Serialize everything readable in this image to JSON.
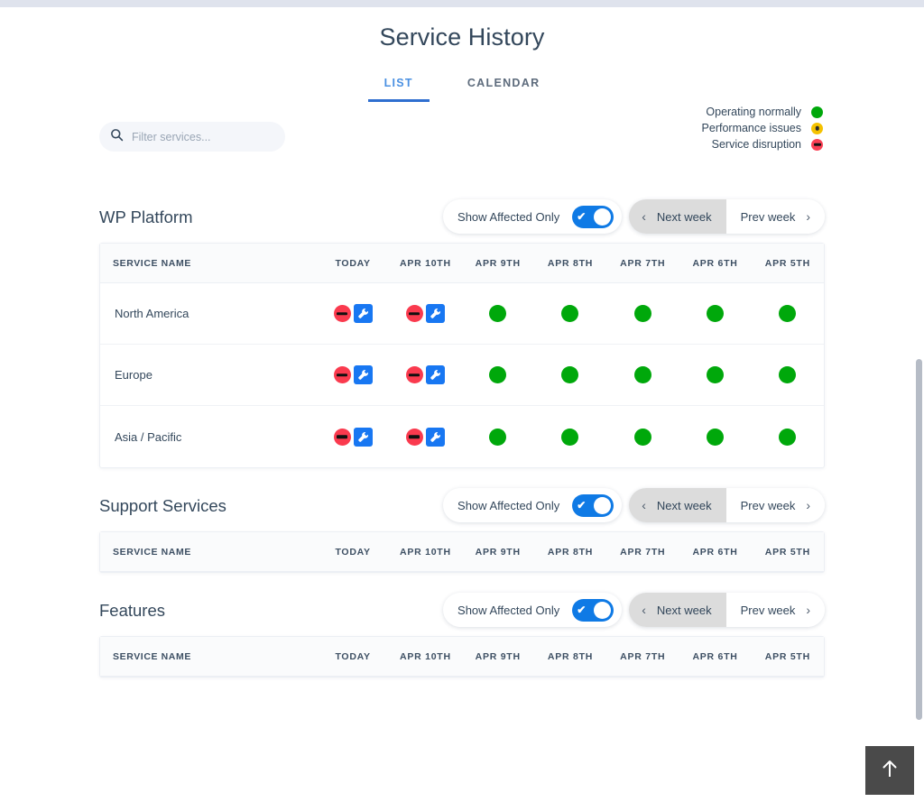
{
  "header": {
    "title": "Service History"
  },
  "tabs": [
    {
      "label": "LIST",
      "active": true
    },
    {
      "label": "CALENDAR",
      "active": false
    }
  ],
  "search": {
    "placeholder": "Filter services...",
    "value": "",
    "icon": "search-icon"
  },
  "legend": {
    "items": [
      {
        "label": "Operating normally",
        "status": "ok",
        "color": "#00a80b"
      },
      {
        "label": "Performance issues",
        "status": "warn",
        "color": "#f5c200"
      },
      {
        "label": "Service disruption",
        "status": "err",
        "color": "#fa4054"
      }
    ]
  },
  "controls": {
    "affected_label": "Show Affected Only",
    "toggle_on": true,
    "next_week_label": "Next week",
    "prev_week_label": "Prev week"
  },
  "columns": [
    "SERVICE NAME",
    "TODAY",
    "APR 10TH",
    "APR 9TH",
    "APR 8TH",
    "APR 7TH",
    "APR 6TH",
    "APR 5TH"
  ],
  "sections": [
    {
      "title": "WP Platform",
      "rows": [
        {
          "name": "North America",
          "days": [
            {
              "status": "err",
              "maintenance": true
            },
            {
              "status": "err",
              "maintenance": true
            },
            {
              "status": "ok",
              "maintenance": false
            },
            {
              "status": "ok",
              "maintenance": false
            },
            {
              "status": "ok",
              "maintenance": false
            },
            {
              "status": "ok",
              "maintenance": false
            },
            {
              "status": "ok",
              "maintenance": false
            }
          ]
        },
        {
          "name": "Europe",
          "days": [
            {
              "status": "err",
              "maintenance": true
            },
            {
              "status": "err",
              "maintenance": true
            },
            {
              "status": "ok",
              "maintenance": false
            },
            {
              "status": "ok",
              "maintenance": false
            },
            {
              "status": "ok",
              "maintenance": false
            },
            {
              "status": "ok",
              "maintenance": false
            },
            {
              "status": "ok",
              "maintenance": false
            }
          ]
        },
        {
          "name": "Asia / Pacific",
          "days": [
            {
              "status": "err",
              "maintenance": true
            },
            {
              "status": "err",
              "maintenance": true
            },
            {
              "status": "ok",
              "maintenance": false
            },
            {
              "status": "ok",
              "maintenance": false
            },
            {
              "status": "ok",
              "maintenance": false
            },
            {
              "status": "ok",
              "maintenance": false
            },
            {
              "status": "ok",
              "maintenance": false
            }
          ]
        }
      ]
    },
    {
      "title": "Support Services",
      "rows": []
    },
    {
      "title": "Features",
      "rows": []
    }
  ],
  "scroll_top": {
    "icon": "arrow-up-icon"
  },
  "colors": {
    "accent": "#0f7ae5",
    "tab_active": "#4a90e2",
    "text": "#33475b",
    "maintenance": "#1877f2"
  }
}
